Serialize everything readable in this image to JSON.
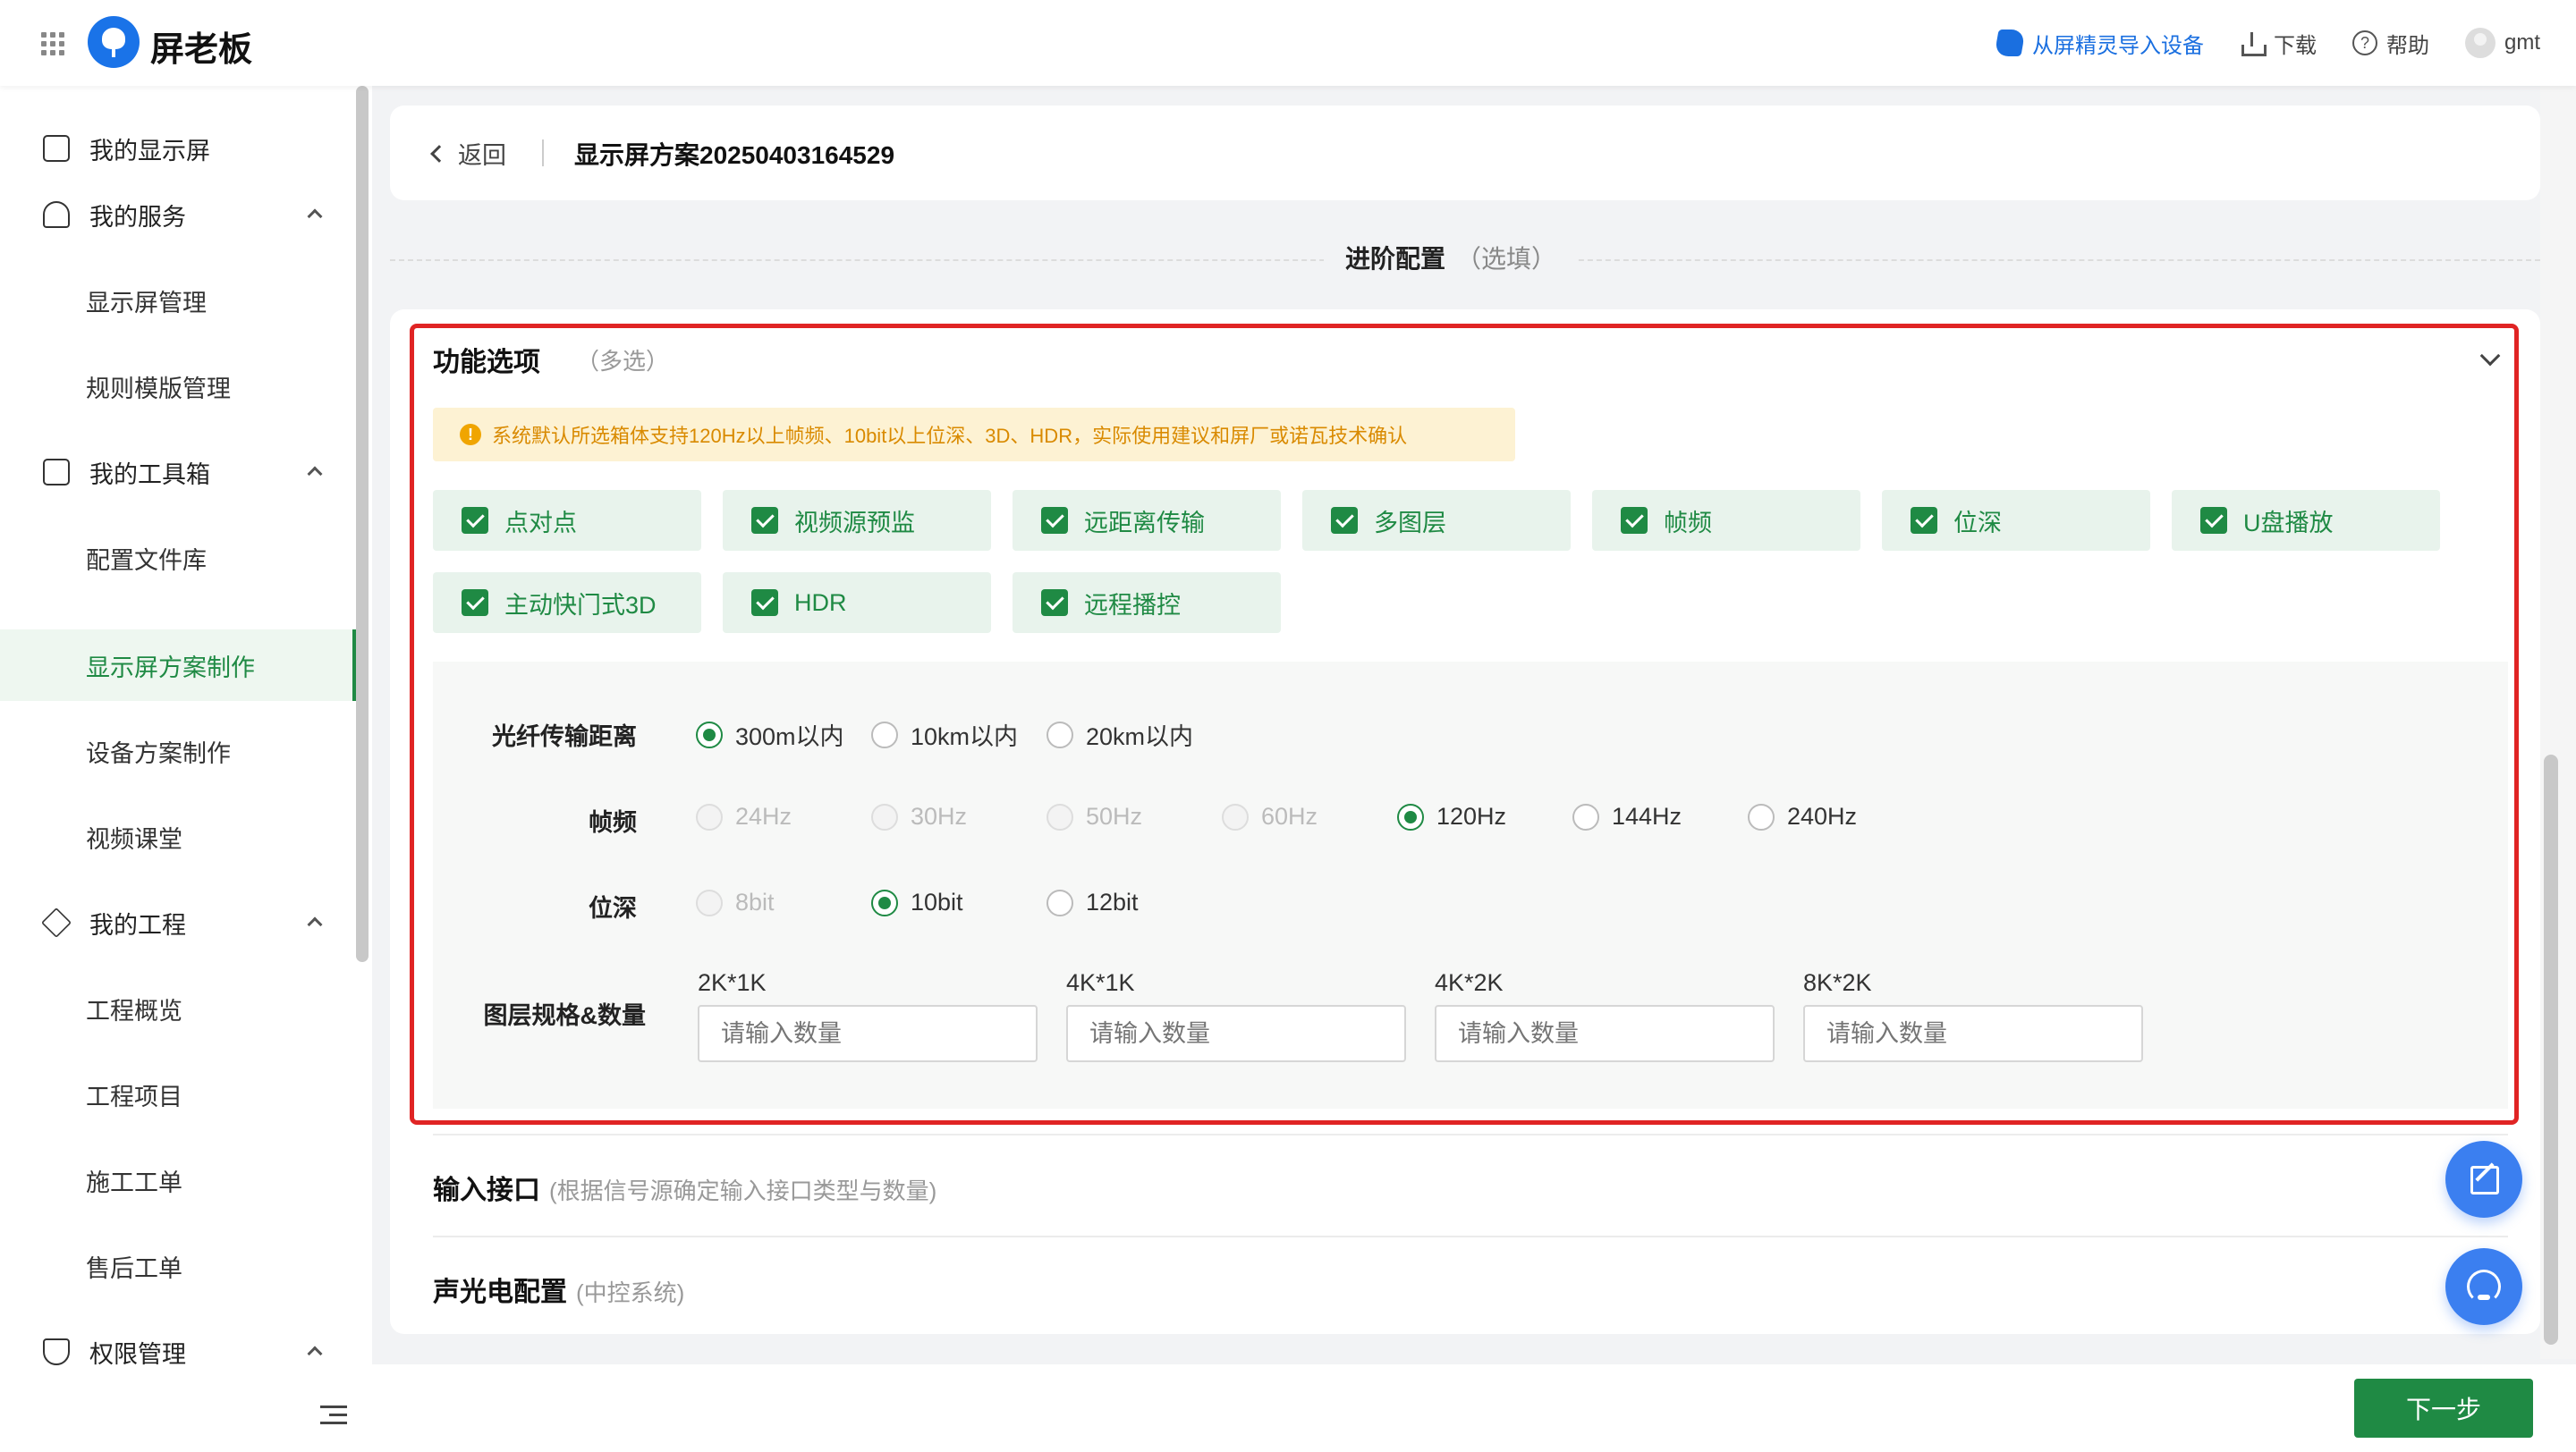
{
  "header": {
    "brand": "屏老板",
    "actions": {
      "import": "从屏精灵导入设备",
      "download": "下载",
      "help": "帮助",
      "user": "gmt"
    }
  },
  "sidebar": {
    "items": [
      {
        "label": "我的显示屏",
        "type": "parent",
        "icon": "monitor-icon"
      },
      {
        "label": "我的服务",
        "type": "parent",
        "icon": "user-icon",
        "expanded": true
      },
      {
        "label": "显示屏管理",
        "type": "child"
      },
      {
        "label": "规则模版管理",
        "type": "child"
      },
      {
        "label": "我的工具箱",
        "type": "parent",
        "icon": "toolbox-icon",
        "expanded": true
      },
      {
        "label": "配置文件库",
        "type": "child"
      },
      {
        "label": "显示屏方案制作",
        "type": "child",
        "active": true
      },
      {
        "label": "设备方案制作",
        "type": "child"
      },
      {
        "label": "视频课堂",
        "type": "child"
      },
      {
        "label": "我的工程",
        "type": "parent",
        "icon": "layers-icon",
        "expanded": true
      },
      {
        "label": "工程概览",
        "type": "child"
      },
      {
        "label": "工程项目",
        "type": "child"
      },
      {
        "label": "施工工单",
        "type": "child"
      },
      {
        "label": "售后工单",
        "type": "child"
      },
      {
        "label": "权限管理",
        "type": "parent",
        "icon": "shield-icon",
        "expanded": true
      }
    ]
  },
  "topbar": {
    "back_label": "返回",
    "title": "显示屏方案20250403164529"
  },
  "section": {
    "title": "进阶配置",
    "subtitle": "（选填）"
  },
  "features": {
    "title": "功能选项",
    "subtitle": "（多选）",
    "notice": "系统默认所选箱体支持120Hz以上帧频、10bit以上位深、3D、HDR，实际使用建议和屏厂或诺瓦技术确认",
    "options": [
      "点对点",
      "视频源预监",
      "远距离传输",
      "多图层",
      "帧频",
      "位深",
      "U盘播放",
      "主动快门式3D",
      "HDR",
      "远程播控"
    ]
  },
  "fiber": {
    "label": "光纤传输距离",
    "options": [
      "300m以内",
      "10km以内",
      "20km以内"
    ],
    "selected": "300m以内"
  },
  "framerate": {
    "label": "帧频",
    "options": [
      "24Hz",
      "30Hz",
      "50Hz",
      "60Hz",
      "120Hz",
      "144Hz",
      "240Hz"
    ],
    "selected": "120Hz",
    "disabled": [
      "24Hz",
      "30Hz",
      "50Hz",
      "60Hz"
    ]
  },
  "bitdepth": {
    "label": "位深",
    "options": [
      "8bit",
      "10bit",
      "12bit"
    ],
    "selected": "10bit",
    "disabled": [
      "8bit"
    ]
  },
  "layers": {
    "label": "图层规格&数量",
    "specs": [
      {
        "name": "2K*1K",
        "placeholder": "请输入数量"
      },
      {
        "name": "4K*1K",
        "placeholder": "请输入数量"
      },
      {
        "name": "4K*2K",
        "placeholder": "请输入数量"
      },
      {
        "name": "8K*2K",
        "placeholder": "请输入数量"
      }
    ]
  },
  "input_port": {
    "title": "输入接口",
    "subtitle": "(根据信号源确定输入接口类型与数量)"
  },
  "av_config": {
    "title": "声光电配置",
    "subtitle": "(中控系统)"
  },
  "footer": {
    "next_label": "下一步"
  },
  "colors": {
    "accent_green": "#1f8a44",
    "highlight_red": "#e02424",
    "fab_blue": "#3b7ff0",
    "warn_orange": "#d98a00"
  }
}
